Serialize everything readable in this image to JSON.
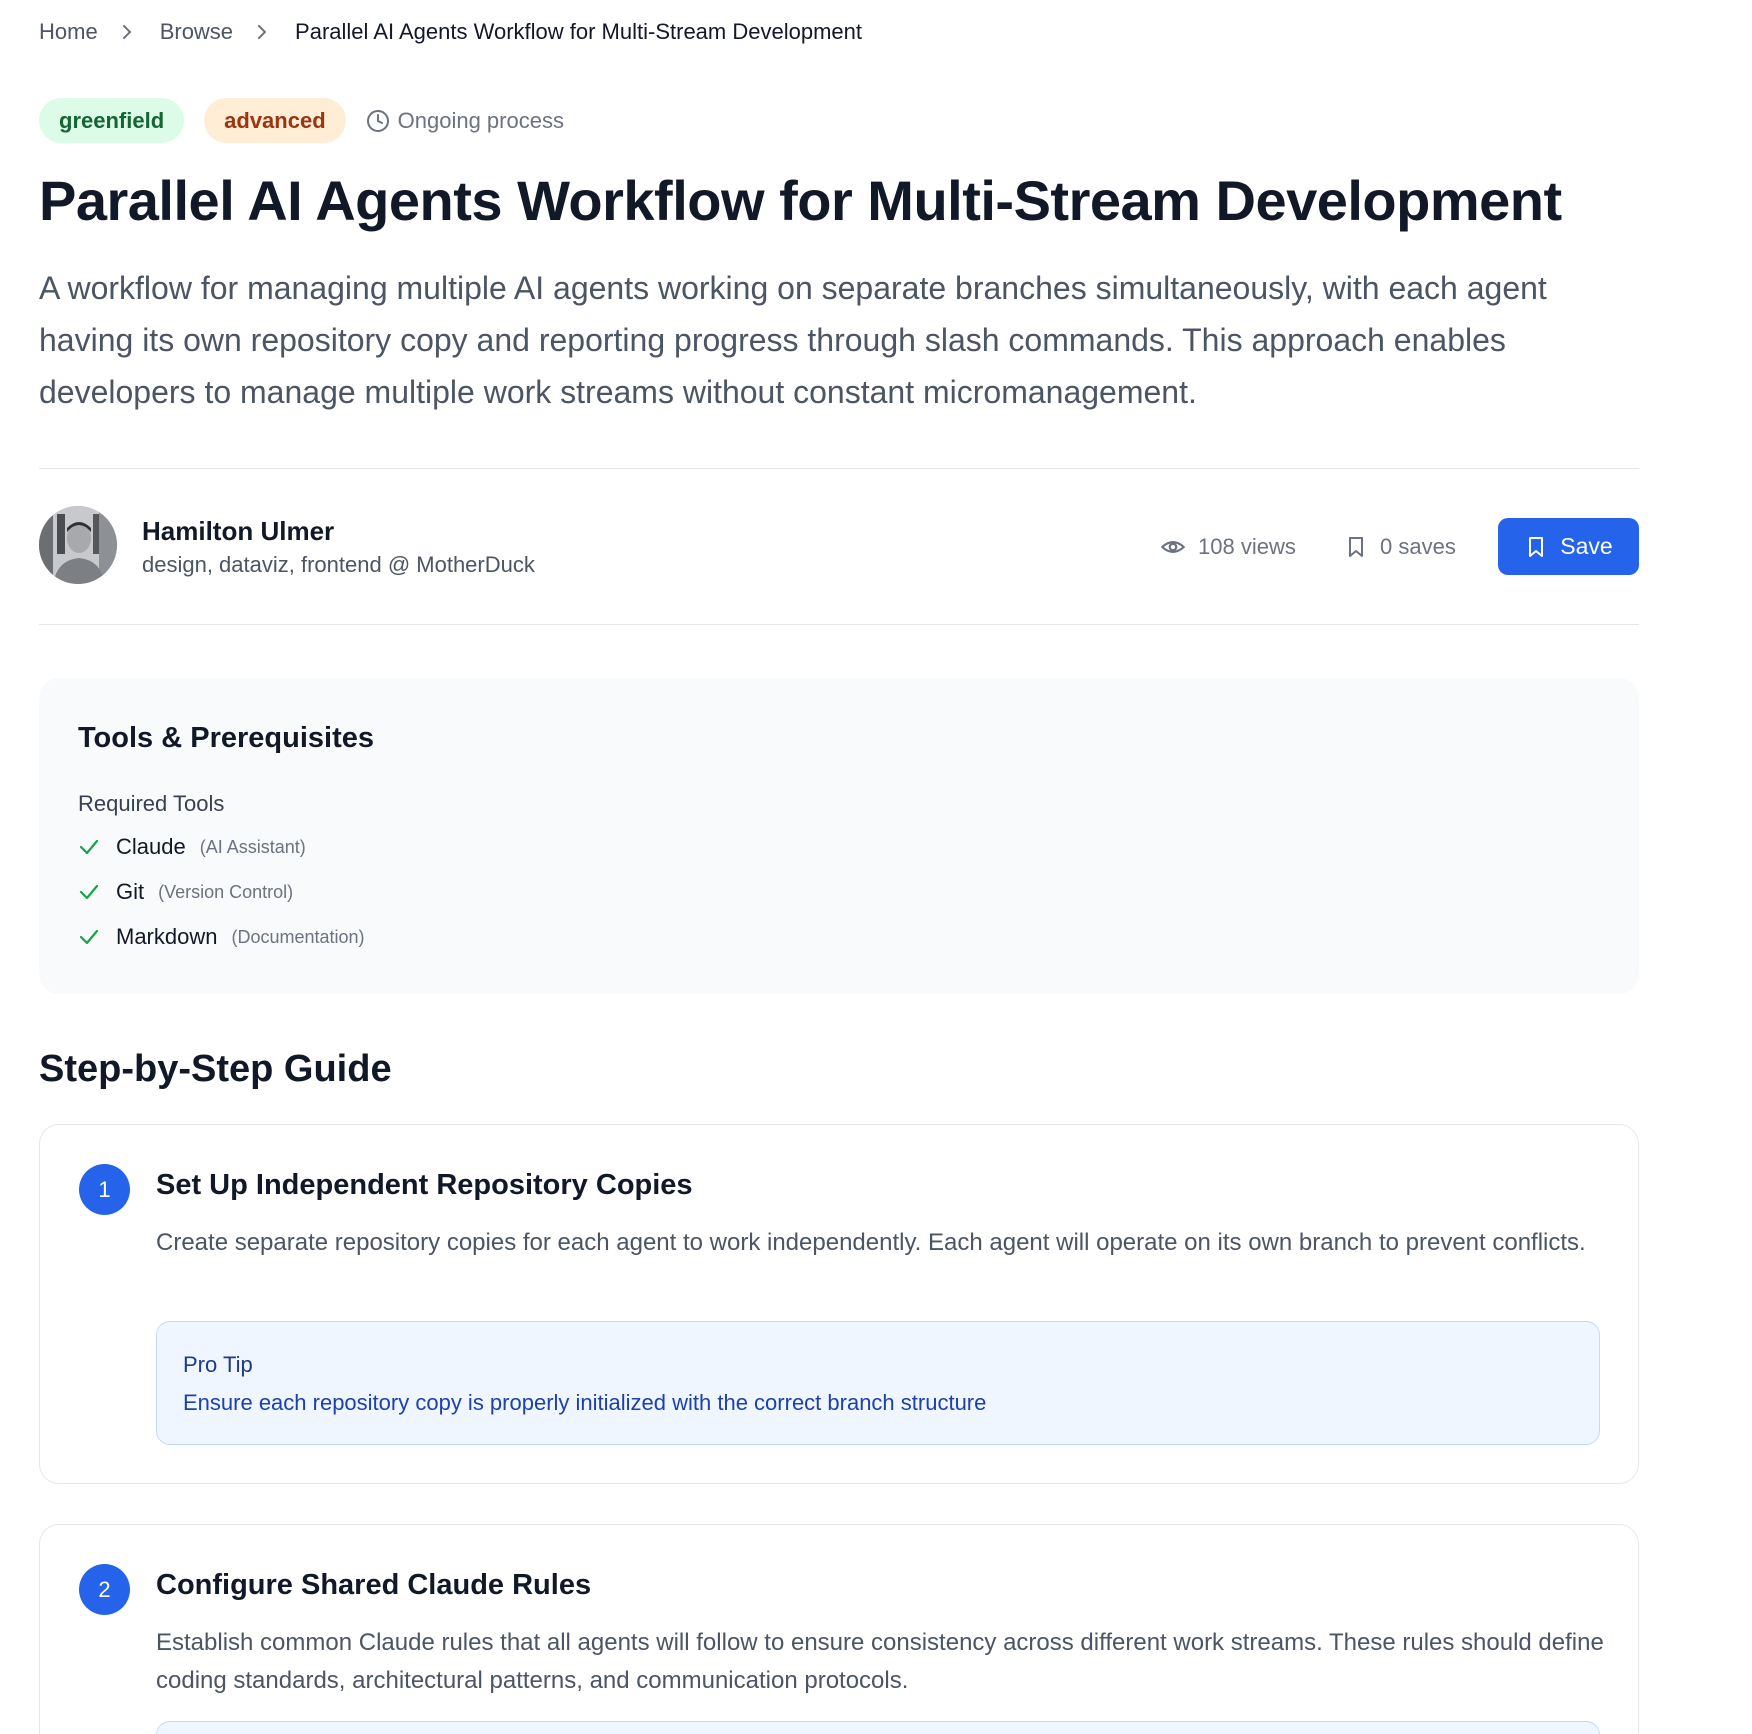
{
  "breadcrumb": {
    "home": "Home",
    "browse": "Browse",
    "current": "Parallel AI Agents Workflow for Multi-Stream Development"
  },
  "tags": {
    "difficulty_type": "greenfield",
    "level": "advanced",
    "process": "Ongoing process"
  },
  "title": "Parallel AI Agents Workflow for Multi-Stream Development",
  "description": "A workflow for managing multiple AI agents working on separate branches simultaneously, with each agent having its own repository copy and reporting progress through slash commands. This approach enables developers to manage multiple work streams without constant micromanagement.",
  "author": {
    "name": "Hamilton Ulmer",
    "role": "design, dataviz, frontend @ MotherDuck"
  },
  "stats": {
    "views": "108 views",
    "saves": "0 saves",
    "save_label": "Save"
  },
  "tools": {
    "title": "Tools & Prerequisites",
    "subtitle": "Required Tools",
    "items": [
      {
        "name": "Claude",
        "category": "(AI Assistant)"
      },
      {
        "name": "Git",
        "category": "(Version Control)"
      },
      {
        "name": "Markdown",
        "category": "(Documentation)"
      }
    ]
  },
  "guide": {
    "title": "Step-by-Step Guide",
    "steps": [
      {
        "number": "1",
        "title": "Set Up Independent Repository Copies",
        "description": "Create separate repository copies for each agent to work independently. Each agent will operate on its own branch to prevent conflicts.",
        "tip_label": "Pro Tip",
        "tip_text": "Ensure each repository copy is properly initialized with the correct branch structure"
      },
      {
        "number": "2",
        "title": "Configure Shared Claude Rules",
        "description": "Establish common Claude rules that all agents will follow to ensure consistency across different work streams. These rules should define coding standards, architectural patterns, and communication protocols."
      }
    ]
  },
  "colors": {
    "accent": "#2563eb",
    "tag_green_bg": "#dcfce7",
    "tag_orange_bg": "#ffedd5",
    "check": "#16a34a"
  }
}
